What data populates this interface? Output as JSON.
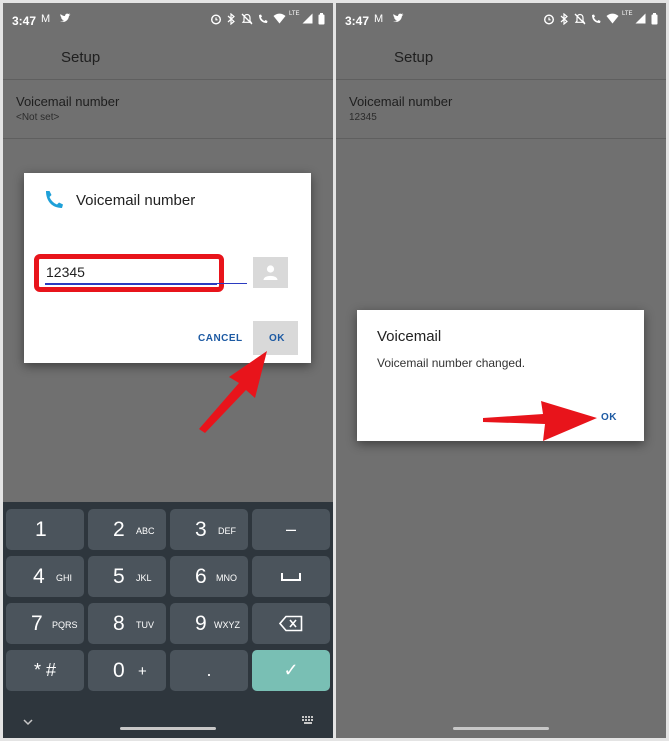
{
  "left": {
    "status": {
      "time": "3:47"
    },
    "appbar": {
      "title": "Setup"
    },
    "setting": {
      "label": "Voicemail number",
      "value": "<Not set>"
    },
    "dialog": {
      "title": "Voicemail number",
      "input_value": "12345",
      "cancel_label": "CANCEL",
      "ok_label": "OK"
    },
    "keypad": {
      "keys": [
        {
          "digit": "1",
          "letters": ""
        },
        {
          "digit": "2",
          "letters": "ABC"
        },
        {
          "digit": "3",
          "letters": "DEF"
        },
        {
          "digit": "4",
          "letters": "GHI"
        },
        {
          "digit": "5",
          "letters": "JKL"
        },
        {
          "digit": "6",
          "letters": "MNO"
        },
        {
          "digit": "7",
          "letters": "PQRS"
        },
        {
          "digit": "8",
          "letters": "TUV"
        },
        {
          "digit": "9",
          "letters": "WXYZ"
        },
        {
          "digit": "0",
          "letters": "+"
        }
      ],
      "dash": "–",
      "star_hash": "* #",
      "dot": ".",
      "check": "✓"
    }
  },
  "right": {
    "status": {
      "time": "3:47"
    },
    "appbar": {
      "title": "Setup"
    },
    "setting": {
      "label": "Voicemail number",
      "value": "12345"
    },
    "dialog": {
      "title": "Voicemail",
      "message": "Voicemail number changed.",
      "ok_label": "OK"
    }
  },
  "colors": {
    "highlight_red": "#e8141b",
    "accent_blue": "#1d5aa3",
    "phone_icon": "#1ea0d8",
    "keypad_bg": "#2e363d",
    "key_bg": "#4b545c",
    "key_done": "#79bfb4"
  },
  "icons": [
    "gmail-icon",
    "twitter-icon",
    "alarm-icon",
    "bluetooth-icon",
    "mute-icon",
    "call-icon",
    "wifi-icon",
    "signal-icon",
    "battery-icon",
    "phone-icon",
    "contact-picker-icon",
    "space-icon",
    "backspace-icon",
    "chevron-down-icon",
    "keyboard-icon"
  ]
}
